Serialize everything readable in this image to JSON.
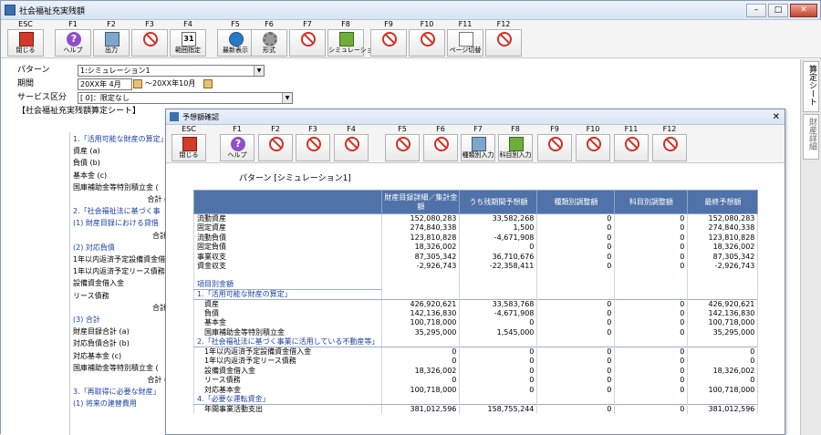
{
  "window": {
    "title": "社会福祉充実残額"
  },
  "toolbar": [
    {
      "key": "ESC",
      "label": "閉じる",
      "icon": "exit-icon"
    },
    {
      "key": "F1",
      "label": "ヘルプ",
      "icon": "help-icon"
    },
    {
      "key": "F2",
      "label": "出力",
      "icon": "print-icon"
    },
    {
      "key": "F3",
      "label": "",
      "icon": "disabled-icon"
    },
    {
      "key": "F4",
      "label": "範囲指定",
      "icon": "calendar-icon"
    },
    {
      "key": "F5",
      "label": "最新表示",
      "icon": "refresh-icon"
    },
    {
      "key": "F6",
      "label": "形式",
      "icon": "gear-icon"
    },
    {
      "key": "F7",
      "label": "",
      "icon": "disabled-icon"
    },
    {
      "key": "F8",
      "label": "シミュレーション",
      "icon": "simulation-icon"
    },
    {
      "key": "F9",
      "label": "",
      "icon": "disabled-icon"
    },
    {
      "key": "F10",
      "label": "",
      "icon": "disabled-icon"
    },
    {
      "key": "F11",
      "label": "ページ切替",
      "icon": "page-switch-icon"
    },
    {
      "key": "F12",
      "label": "",
      "icon": "disabled-icon"
    }
  ],
  "form": {
    "pattern_label": "パターン",
    "pattern_value": "1:シミュレーション1",
    "period_label": "期間",
    "period_from": "20XX年 4月",
    "period_to": "～20XX年10月",
    "service_label": "サービス区分",
    "service_value": "[ 0]：限定なし",
    "sheet_title": "【社会福祉充実残額算定シート】"
  },
  "side_tabs": [
    "算定シート",
    "財産詳細"
  ],
  "bg_lines": [
    {
      "t": "1.「活用可能な財産の算定」",
      "c": "blue"
    },
    {
      "t": "資産 (a)"
    },
    {
      "t": "負債 (b)"
    },
    {
      "t": "基本金 (c)"
    },
    {
      "t": "国庫補助金等特別積立金 ("
    },
    {
      "t": "合計 (",
      "r": true
    },
    {
      "t": "2.「社会福祉法に基づく事",
      "c": "blue"
    },
    {
      "t": "(1) 財産目録における貸借",
      "c": "blue"
    },
    {
      "t": "合計",
      "r": true
    },
    {
      "t": "(2) 対応負債",
      "c": "blue"
    },
    {
      "t": "1年以内返済予定設備資金借"
    },
    {
      "t": "1年以内返済予定リース債務"
    },
    {
      "t": "設備資金借入金"
    },
    {
      "t": "リース債務"
    },
    {
      "t": "合計",
      "r": true
    },
    {
      "t": "(3) 合計",
      "c": "blue"
    },
    {
      "t": "財産目録合計 (a)"
    },
    {
      "t": "対応負債合計 (b)"
    },
    {
      "t": "対応基本金 (c)"
    },
    {
      "t": "国庫補助金等特別積立金 ("
    },
    {
      "t": "合計 (",
      "r": true
    },
    {
      "t": "3.「再取得に必要な財産」",
      "c": "blue"
    },
    {
      "t": "(1) 将来の建替費用",
      "c": "blue"
    }
  ],
  "dialog": {
    "title": "予想額確認",
    "toolbar": [
      {
        "key": "ESC",
        "label": "閉じる",
        "icon": "exit-icon"
      },
      {
        "key": "F1",
        "label": "ヘルプ",
        "icon": "help-icon"
      },
      {
        "key": "F2",
        "label": "",
        "icon": "disabled-icon"
      },
      {
        "key": "F3",
        "label": "",
        "icon": "disabled-icon"
      },
      {
        "key": "F4",
        "label": "",
        "icon": "disabled-icon"
      },
      {
        "key": "F5",
        "label": "",
        "icon": "disabled-icon"
      },
      {
        "key": "F6",
        "label": "",
        "icon": "disabled-icon"
      },
      {
        "key": "F7",
        "label": "種類別入力",
        "icon": "book-blue-icon"
      },
      {
        "key": "F8",
        "label": "科目別入力",
        "icon": "book-green-icon"
      },
      {
        "key": "F9",
        "label": "",
        "icon": "disabled-icon"
      },
      {
        "key": "F10",
        "label": "",
        "icon": "disabled-icon"
      },
      {
        "key": "F11",
        "label": "",
        "icon": "disabled-icon"
      },
      {
        "key": "F12",
        "label": "",
        "icon": "disabled-icon"
      }
    ],
    "pattern": "パターン [シミュレーション1]",
    "columns": [
      "",
      "財産目録詳細／集計金額",
      "うち残期間予想額",
      "種類別調整額",
      "科目別調整額",
      "最終予想額"
    ],
    "rows": [
      {
        "type": "row",
        "cells": [
          "流動資産",
          "152,080,283",
          "33,582,268",
          "0",
          "0",
          "152,080,283"
        ]
      },
      {
        "type": "row",
        "cells": [
          "固定資産",
          "274,840,338",
          "1,500",
          "0",
          "0",
          "274,840,338"
        ]
      },
      {
        "type": "row",
        "cells": [
          "流動負債",
          "123,810,828",
          "-4,671,908",
          "0",
          "0",
          "123,810,828"
        ]
      },
      {
        "type": "row",
        "cells": [
          "固定負債",
          "18,326,002",
          "0",
          "0",
          "0",
          "18,326,002"
        ]
      },
      {
        "type": "row",
        "cells": [
          "事業収支",
          "87,305,342",
          "36,710,676",
          "0",
          "0",
          "87,305,342"
        ]
      },
      {
        "type": "row",
        "cells": [
          "資金収支",
          "-2,926,743",
          "-22,358,411",
          "0",
          "0",
          "-2,926,743"
        ]
      },
      {
        "type": "sep",
        "cells": [
          "",
          "",
          "",
          "",
          "",
          ""
        ]
      },
      {
        "type": "sect",
        "cells": [
          "項目別金額",
          "",
          "",
          "",
          "",
          ""
        ]
      },
      {
        "type": "sect",
        "cells": [
          "1.「活用可能な財産の算定」",
          "",
          "",
          "",
          "",
          ""
        ]
      },
      {
        "type": "row",
        "cells": [
          "　資産",
          "426,920,621",
          "33,583,768",
          "0",
          "0",
          "426,920,621"
        ]
      },
      {
        "type": "row",
        "cells": [
          "　負債",
          "142,136,830",
          "-4,671,908",
          "0",
          "0",
          "142,136,830"
        ]
      },
      {
        "type": "row",
        "cells": [
          "　基本金",
          "100,718,000",
          "0",
          "0",
          "0",
          "100,718,000"
        ]
      },
      {
        "type": "row",
        "cells": [
          "　国庫補助金等特別積立金",
          "35,295,000",
          "1,545,000",
          "0",
          "0",
          "35,295,000"
        ]
      },
      {
        "type": "sect",
        "cells": [
          "2.「社会福祉法に基づく事業に活用している不動産等」",
          "",
          "",
          "",
          "",
          ""
        ]
      },
      {
        "type": "row",
        "cells": [
          "　1年以内返済予定設備資金借入金",
          "0",
          "0",
          "0",
          "0",
          "0"
        ]
      },
      {
        "type": "row",
        "cells": [
          "　1年以内返済予定リース債務",
          "0",
          "0",
          "0",
          "0",
          "0"
        ]
      },
      {
        "type": "row",
        "cells": [
          "　設備資金借入金",
          "18,326,002",
          "0",
          "0",
          "0",
          "18,326,002"
        ]
      },
      {
        "type": "row",
        "cells": [
          "　リース債務",
          "0",
          "0",
          "0",
          "0",
          "0"
        ]
      },
      {
        "type": "row",
        "cells": [
          "　対応基本金",
          "100,718,000",
          "0",
          "0",
          "0",
          "100,718,000"
        ]
      },
      {
        "type": "sect",
        "cells": [
          "4.「必要な運転資金」",
          "",
          "",
          "",
          "",
          ""
        ]
      },
      {
        "type": "row",
        "cells": [
          "　年間事業活動支出",
          "381,012,596",
          "158,755,244",
          "0",
          "0",
          "381,012,596"
        ]
      }
    ]
  }
}
